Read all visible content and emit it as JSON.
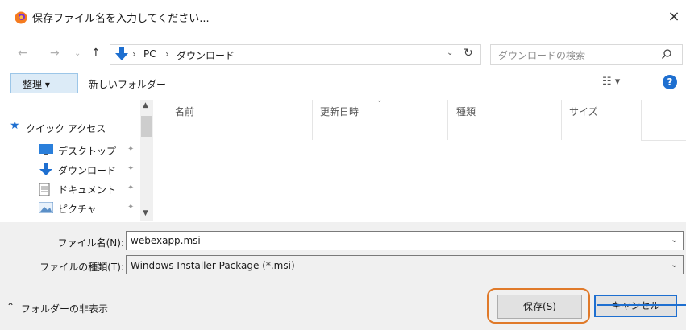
{
  "window": {
    "title": "保存ファイル名を入力してください...",
    "close": "×"
  },
  "address": {
    "crumbs": [
      "PC",
      "ダウンロード"
    ],
    "sep": "›",
    "search_placeholder": "ダウンロードの検索"
  },
  "toolbar": {
    "organize": "整理 ▾",
    "new_folder": "新しいフォルダー",
    "help": "?"
  },
  "nav": {
    "items": [
      {
        "label": "クイック アクセス",
        "icon": "star-icon"
      },
      {
        "label": "デスクトップ",
        "icon": "desktop-icon"
      },
      {
        "label": "ダウンロード",
        "icon": "download-icon"
      },
      {
        "label": "ドキュメント",
        "icon": "document-icon"
      },
      {
        "label": "ピクチャ",
        "icon": "pictures-icon"
      }
    ]
  },
  "columns": [
    "名前",
    "更新日時",
    "種類",
    "サイズ"
  ],
  "form": {
    "filename_label": "ファイル名(N):",
    "filename_value": "webexapp.msi",
    "filetype_label": "ファイルの種類(T):",
    "filetype_value": "Windows Installer Package (*.msi)"
  },
  "footer": {
    "hide_folders": "フォルダーの非表示",
    "save": "保存(S)",
    "cancel": "キャンセル"
  },
  "colors": {
    "accent": "#1e6fd0",
    "highlight_ring": "#e07a2a"
  }
}
